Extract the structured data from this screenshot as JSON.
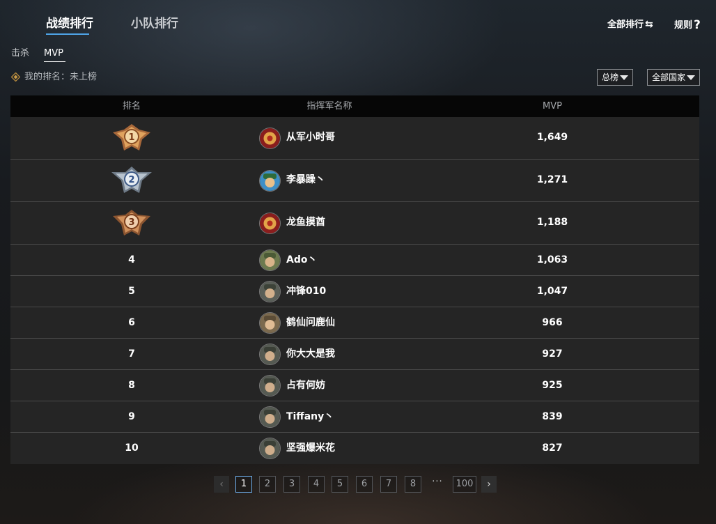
{
  "main_tabs": [
    {
      "label": "战绩排行",
      "active": true
    },
    {
      "label": "小队排行",
      "active": false
    }
  ],
  "top_links": {
    "all_rankings": "全部排行",
    "rules": "规则"
  },
  "sub_tabs": [
    {
      "label": "击杀",
      "active": false
    },
    {
      "label": "MVP",
      "active": true
    }
  ],
  "my_rank": {
    "label": "我的排名：未上榜"
  },
  "filters": {
    "board": "总榜",
    "country": "全部国家"
  },
  "table": {
    "headers": {
      "rank": "排名",
      "commander": "指挥军名称",
      "mvp": "MVP"
    },
    "rows": [
      {
        "rank": "1",
        "name": "从军小时哥",
        "mvp": "1,649",
        "medal": "gold"
      },
      {
        "rank": "2",
        "name": "李暴躁丶",
        "mvp": "1,271",
        "medal": "silver"
      },
      {
        "rank": "3",
        "name": "龙鱼摸酋",
        "mvp": "1,188",
        "medal": "bronze"
      },
      {
        "rank": "4",
        "name": "Ado丶",
        "mvp": "1,063"
      },
      {
        "rank": "5",
        "name": "冲锋010",
        "mvp": "1,047"
      },
      {
        "rank": "6",
        "name": "鹤仙问鹿仙",
        "mvp": "966"
      },
      {
        "rank": "7",
        "name": "你大大是我",
        "mvp": "927"
      },
      {
        "rank": "8",
        "name": "占有何妨",
        "mvp": "925"
      },
      {
        "rank": "9",
        "name": "Tiffany丶",
        "mvp": "839"
      },
      {
        "rank": "10",
        "name": "坚强爆米花",
        "mvp": "827"
      }
    ]
  },
  "pagination": {
    "prev": "‹",
    "next": "›",
    "pages": [
      "1",
      "2",
      "3",
      "4",
      "5",
      "6",
      "7",
      "8"
    ],
    "ellipsis": "···",
    "last": "100",
    "current": "1"
  },
  "colors": {
    "accent": "#4ea3e6",
    "gold_medal": "#d89a55",
    "silver_medal": "#a9b4c0",
    "bronze_medal": "#c98a58"
  }
}
